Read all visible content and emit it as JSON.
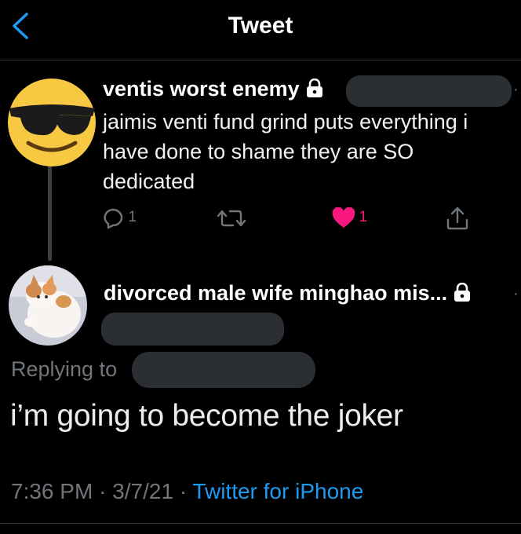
{
  "header": {
    "title": "Tweet",
    "back_icon": "chevron-left-icon",
    "accent": "#1d9bf0"
  },
  "parent_tweet": {
    "display_name": "ventis worst enemy",
    "protected_icon": "lock-icon",
    "avatar_icon": "sunglasses-emoji-avatar",
    "text": "jaimis venti fund grind puts everything i have done to shame they are SO dedicated",
    "replies": "1",
    "likes": "1",
    "liked": true,
    "like_color": "#f91880"
  },
  "reply_tweet": {
    "display_name": "divorced male wife minghao mis...",
    "protected_icon": "lock-icon",
    "avatar_icon": "cat-photo-avatar",
    "replying_label": "Replying to",
    "text": "i’m going to become the joker",
    "time": "7:36 PM",
    "separator": "·",
    "date": "3/7/21",
    "source": "Twitter for iPhone"
  }
}
